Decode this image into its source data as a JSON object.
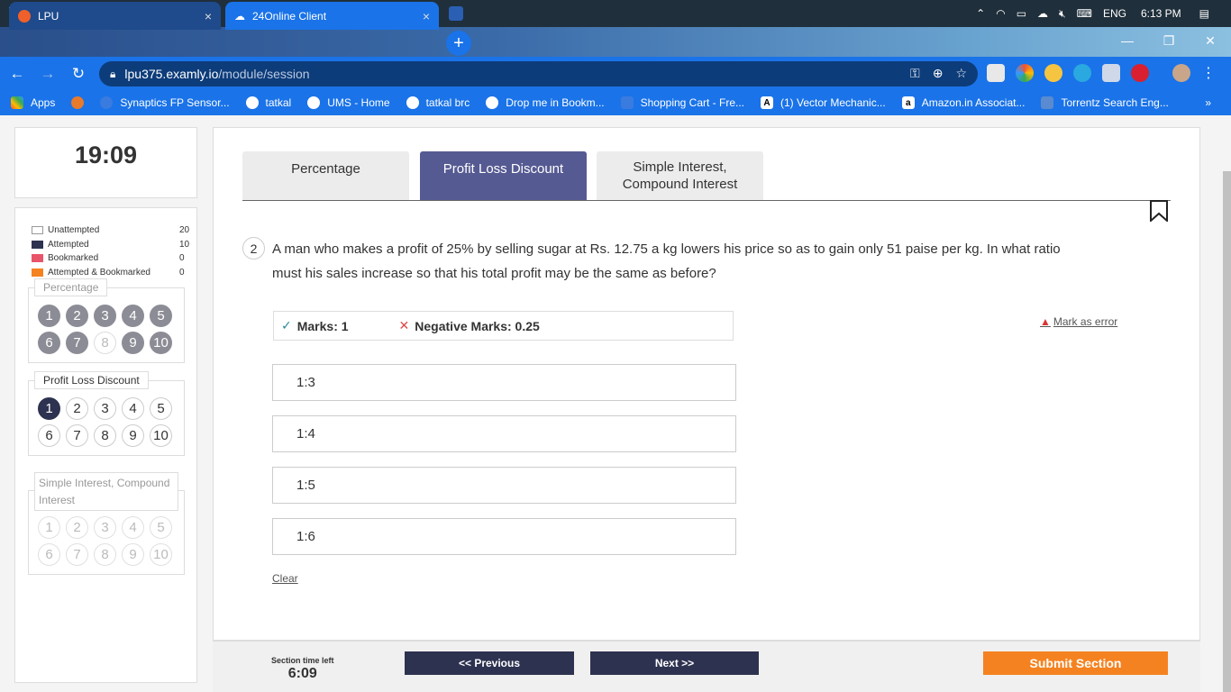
{
  "taskbar": {
    "clock": "6:13 PM",
    "language": "ENG",
    "icons": [
      "windows-icon",
      "search-icon",
      "cortana-icon",
      "task-view-icon",
      "chrome-icon",
      "file-explorer-icon",
      "edge-icon",
      "store-icon",
      "mail-icon",
      "app-p-icon",
      "app-s-icon",
      "firefox-icon",
      "sticky-notes-icon",
      "acrobat-icon",
      "word-icon"
    ]
  },
  "browser": {
    "tabs": [
      {
        "title": "LPU",
        "icon": "lpu-icon"
      },
      {
        "title": "24Online Client",
        "icon": "cloud-icon"
      }
    ],
    "url_host": "lpu375.examly.io",
    "url_path": "/module/session",
    "bookmarks": [
      {
        "label": "Apps"
      },
      {
        "label": ""
      },
      {
        "label": "Synaptics FP Sensor..."
      },
      {
        "label": "tatkal"
      },
      {
        "label": "UMS - Home"
      },
      {
        "label": "tatkal brc"
      },
      {
        "label": "Drop me in Bookm..."
      },
      {
        "label": "Shopping Cart - Fre..."
      },
      {
        "label": "(1) Vector Mechanic..."
      },
      {
        "label": "Amazon.in Associat..."
      },
      {
        "label": "Torrentz Search Eng..."
      }
    ],
    "more": "»"
  },
  "timer": "19:09",
  "legend": [
    {
      "label": "Unattempted",
      "count": "20",
      "color": "#ffffff"
    },
    {
      "label": "Attempted",
      "count": "10",
      "color": "#2d3250"
    },
    {
      "label": "Bookmarked",
      "count": "0",
      "color": "#e8546a"
    },
    {
      "label": "Attempted & Bookmarked",
      "count": "0",
      "color": "#f58220"
    }
  ],
  "sections": [
    {
      "label": "Percentage",
      "numbers": [
        "1",
        "2",
        "3",
        "4",
        "5",
        "6",
        "7",
        "8",
        "9",
        "10"
      ]
    },
    {
      "label": "Profit Loss Discount",
      "numbers": [
        "1",
        "2",
        "3",
        "4",
        "5",
        "6",
        "7",
        "8",
        "9",
        "10"
      ]
    },
    {
      "label": "Simple Interest, Compound Interest",
      "numbers": [
        "1",
        "2",
        "3",
        "4",
        "5",
        "6",
        "7",
        "8",
        "9",
        "10"
      ]
    }
  ],
  "topic_tabs": [
    {
      "label": "Percentage"
    },
    {
      "label": "Profit Loss Discount"
    },
    {
      "label_line1": "Simple Interest,",
      "label_line2": "Compound Interest"
    }
  ],
  "question": {
    "number": "2",
    "text": "A man who makes a profit of 25% by selling sugar at Rs. 12.75 a kg lowers his price so as to gain only 51 paise per kg. In what ratio must his sales increase so that his total profit may be the same as before?",
    "marks": "Marks: 1",
    "negative": "Negative Marks: 0.25",
    "mark_error": "Mark as error",
    "options": [
      "1:3",
      "1:4",
      "1:5",
      "1:6"
    ],
    "clear": "Clear"
  },
  "footer": {
    "section_time_label": "Section time left",
    "section_time": "6:09",
    "previous": "<< Previous",
    "next": "Next >>",
    "submit": "Submit Section"
  }
}
